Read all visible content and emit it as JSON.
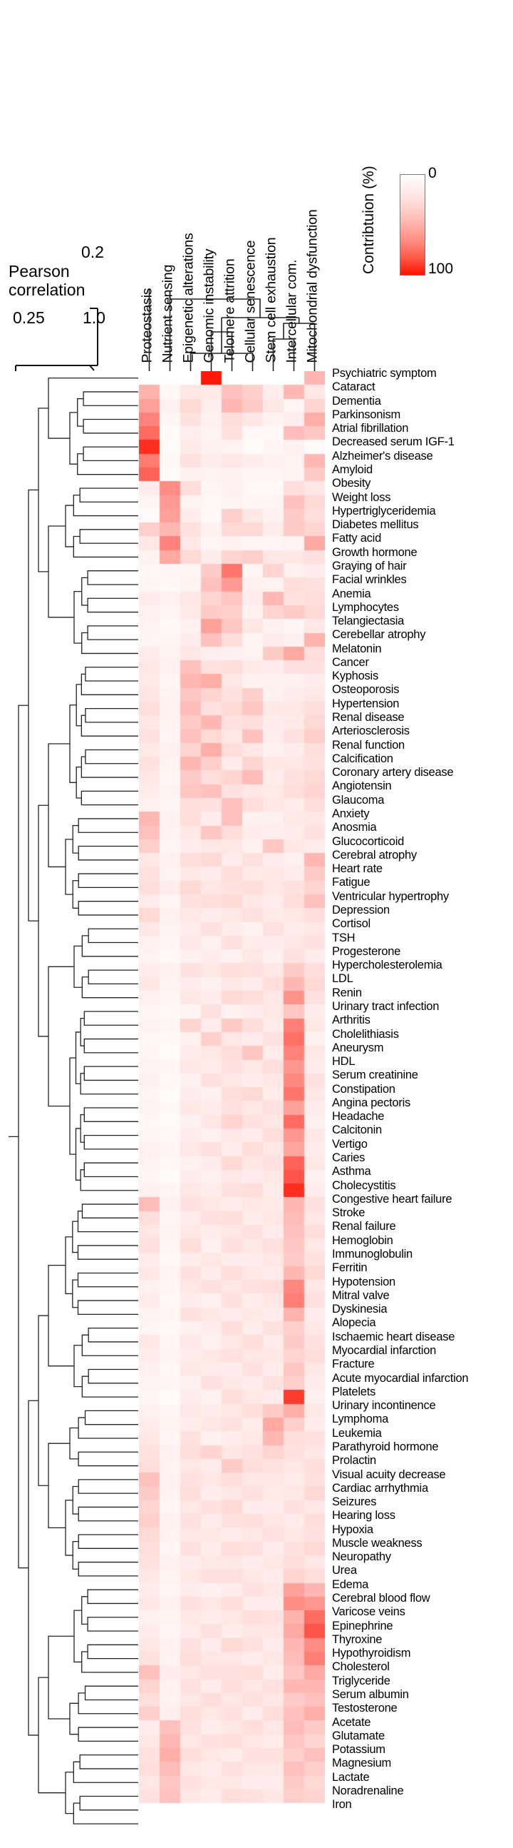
{
  "legend": {
    "title": "Contribtuion (%)",
    "max_label": "0",
    "min_label": "100",
    "color_low": "#ffffff",
    "color_high": "#ff1100"
  },
  "pearson": {
    "top_tick": "0.2",
    "label": "Pearson\ncorrelation",
    "label_line1": "Pearson",
    "label_line2": "correlation",
    "axis_low": "0.25",
    "axis_high": "1.0"
  },
  "chart_data": {
    "type": "heatmap",
    "title": "",
    "xlabel": "",
    "ylabel": "",
    "colorbar": {
      "label": "Contribtuion (%)",
      "min": 0,
      "max": 100,
      "low_color": "#ffffff",
      "high_color": "#ff1100"
    },
    "columns": [
      "Proteostasis",
      "Nutrient sensing",
      "Epigenetic alterations",
      "Genomic instability",
      "Telomere attrition",
      "Cellular senescence",
      "Stem cell exhaustion",
      "Intercellular com.",
      "Mitochondrial dysfunction"
    ],
    "rows": [
      "Psychiatric symptom",
      "Cataract",
      "Dementia",
      "Parkinsonism",
      "Atrial fibrillation",
      "Decreased serum IGF-1",
      "Alzheimer's disease",
      "Amyloid",
      "Obesity",
      "Weight loss",
      "Hypertriglyceridemia",
      "Diabetes mellitus",
      "Fatty acid",
      "Growth hormone",
      "Graying of hair",
      "Facial wrinkles",
      "Anemia",
      "Lymphocytes",
      "Telangiectasia",
      "Cerebellar atrophy",
      "Melatonin",
      "Cancer",
      "Kyphosis",
      "Osteoporosis",
      "Hypertension",
      "Renal disease",
      "Arteriosclerosis",
      "Renal function",
      "Calcification",
      "Coronary artery disease",
      "Angiotensin",
      "Glaucoma",
      "Anxiety",
      "Anosmia",
      "Glucocorticoid",
      "Cerebral atrophy",
      "Heart rate",
      "Fatigue",
      "Ventricular hypertrophy",
      "Depression",
      "Cortisol",
      "TSH",
      "Progesterone",
      "Hypercholesterolemia",
      "LDL",
      "Renin",
      "Urinary tract infection",
      "Arthritis",
      "Cholelithiasis",
      "Aneurysm",
      "HDL",
      "Serum creatinine",
      "Constipation",
      "Angina pectoris",
      "Headache",
      "Calcitonin",
      "Vertigo",
      "Caries",
      "Asthma",
      "Cholecystitis",
      "Congestive heart failure",
      "Stroke",
      "Renal failure",
      "Hemoglobin",
      "Immunoglobulin",
      "Ferritin",
      "Hypotension",
      "Mitral valve",
      "Dyskinesia",
      "Alopecia",
      "Ischaemic heart disease",
      "Myocardial infarction",
      "Fracture",
      "Acute myocardial infarction",
      "Platelets",
      "Urinary incontinence",
      "Lymphoma",
      "Leukemia",
      "Parathyroid hormone",
      "Prolactin",
      "Visual acuity decrease",
      "Cardiac arrhythmia",
      "Seizures",
      "Hearing loss",
      "Hypoxia",
      "Muscle weakness",
      "Neuropathy",
      "Urea",
      "Edema",
      "Cerebral blood flow",
      "Varicose veins",
      "Epinephrine",
      "Thyroxine",
      "Hypothyroidism",
      "Cholesterol",
      "Triglyceride",
      "Serum albumin",
      "Testosterone",
      "Acetate",
      "Glutamate",
      "Potassium",
      "Magnesium",
      "Lactate",
      "Noradrenaline",
      "Iron"
    ],
    "values": [
      [
        0,
        0,
        0,
        96,
        0,
        0,
        0,
        0,
        30
      ],
      [
        32,
        3,
        10,
        9,
        26,
        20,
        7,
        30,
        10
      ],
      [
        40,
        6,
        16,
        7,
        30,
        22,
        10,
        4,
        18
      ],
      [
        52,
        4,
        12,
        6,
        14,
        10,
        5,
        7,
        34
      ],
      [
        62,
        2,
        7,
        5,
        12,
        3,
        3,
        28,
        24
      ],
      [
        88,
        2,
        9,
        6,
        5,
        2,
        4,
        6,
        2
      ],
      [
        55,
        3,
        12,
        8,
        10,
        8,
        6,
        5,
        30
      ],
      [
        66,
        2,
        6,
        5,
        6,
        4,
        4,
        5,
        22
      ],
      [
        8,
        48,
        14,
        4,
        6,
        3,
        3,
        14,
        10
      ],
      [
        4,
        42,
        5,
        3,
        5,
        4,
        4,
        26,
        16
      ],
      [
        2,
        40,
        8,
        3,
        20,
        10,
        6,
        22,
        14
      ],
      [
        20,
        30,
        12,
        6,
        16,
        16,
        8,
        22,
        18
      ],
      [
        10,
        52,
        10,
        4,
        6,
        4,
        4,
        5,
        36
      ],
      [
        5,
        36,
        16,
        8,
        18,
        20,
        10,
        10,
        12
      ],
      [
        3,
        4,
        4,
        22,
        58,
        4,
        18,
        6,
        8
      ],
      [
        4,
        3,
        5,
        26,
        42,
        6,
        5,
        14,
        12
      ],
      [
        8,
        6,
        10,
        18,
        24,
        8,
        30,
        12,
        14
      ],
      [
        6,
        4,
        9,
        22,
        20,
        6,
        18,
        22,
        16
      ],
      [
        5,
        3,
        6,
        40,
        24,
        10,
        6,
        4,
        10
      ],
      [
        4,
        4,
        8,
        26,
        14,
        5,
        8,
        6,
        32
      ],
      [
        8,
        5,
        10,
        7,
        6,
        5,
        22,
        36,
        14
      ],
      [
        10,
        6,
        26,
        12,
        14,
        9,
        8,
        12,
        12
      ],
      [
        9,
        4,
        30,
        34,
        10,
        6,
        6,
        6,
        8
      ],
      [
        11,
        5,
        24,
        18,
        12,
        20,
        6,
        8,
        10
      ],
      [
        14,
        6,
        28,
        12,
        16,
        24,
        10,
        10,
        14
      ],
      [
        10,
        5,
        22,
        30,
        12,
        14,
        8,
        9,
        16
      ],
      [
        12,
        4,
        26,
        16,
        10,
        26,
        7,
        12,
        20
      ],
      [
        9,
        6,
        18,
        34,
        14,
        10,
        6,
        8,
        14
      ],
      [
        12,
        5,
        30,
        20,
        8,
        18,
        10,
        10,
        12
      ],
      [
        10,
        4,
        22,
        14,
        18,
        28,
        8,
        12,
        16
      ],
      [
        8,
        5,
        24,
        26,
        12,
        10,
        9,
        14,
        18
      ],
      [
        6,
        4,
        14,
        12,
        26,
        14,
        10,
        8,
        14
      ],
      [
        30,
        6,
        14,
        8,
        26,
        6,
        6,
        9,
        10
      ],
      [
        26,
        5,
        10,
        24,
        14,
        8,
        7,
        8,
        12
      ],
      [
        20,
        4,
        8,
        10,
        10,
        6,
        24,
        10,
        8
      ],
      [
        10,
        6,
        14,
        16,
        8,
        12,
        8,
        6,
        30
      ],
      [
        12,
        5,
        10,
        8,
        14,
        9,
        10,
        8,
        22
      ],
      [
        14,
        8,
        16,
        10,
        12,
        14,
        10,
        12,
        18
      ],
      [
        8,
        4,
        12,
        14,
        16,
        10,
        8,
        14,
        26
      ],
      [
        16,
        6,
        10,
        8,
        10,
        12,
        9,
        10,
        14
      ],
      [
        10,
        5,
        8,
        12,
        8,
        6,
        12,
        8,
        10
      ],
      [
        6,
        4,
        10,
        6,
        12,
        8,
        8,
        10,
        12
      ],
      [
        5,
        3,
        6,
        8,
        6,
        10,
        6,
        12,
        8
      ],
      [
        8,
        6,
        12,
        10,
        14,
        12,
        10,
        22,
        14
      ],
      [
        10,
        5,
        8,
        6,
        10,
        8,
        14,
        30,
        16
      ],
      [
        6,
        4,
        10,
        8,
        16,
        14,
        10,
        46,
        12
      ],
      [
        4,
        3,
        5,
        12,
        6,
        8,
        10,
        24,
        8
      ],
      [
        5,
        4,
        18,
        8,
        22,
        14,
        8,
        54,
        10
      ],
      [
        3,
        3,
        6,
        20,
        10,
        8,
        12,
        60,
        6
      ],
      [
        4,
        2,
        8,
        10,
        14,
        24,
        8,
        52,
        10
      ],
      [
        5,
        4,
        10,
        8,
        12,
        10,
        14,
        44,
        8
      ],
      [
        6,
        3,
        6,
        12,
        10,
        8,
        10,
        50,
        12
      ],
      [
        4,
        2,
        8,
        6,
        14,
        16,
        8,
        58,
        10
      ],
      [
        5,
        3,
        10,
        8,
        12,
        10,
        12,
        40,
        8
      ],
      [
        3,
        2,
        6,
        10,
        18,
        12,
        10,
        62,
        6
      ],
      [
        4,
        3,
        8,
        6,
        10,
        8,
        14,
        44,
        10
      ],
      [
        6,
        4,
        10,
        12,
        8,
        14,
        10,
        38,
        8
      ],
      [
        5,
        3,
        6,
        8,
        16,
        10,
        12,
        66,
        10
      ],
      [
        4,
        2,
        8,
        6,
        10,
        8,
        10,
        72,
        6
      ],
      [
        6,
        4,
        10,
        8,
        12,
        14,
        8,
        88,
        8
      ],
      [
        28,
        6,
        12,
        10,
        8,
        10,
        9,
        30,
        12
      ],
      [
        14,
        4,
        8,
        12,
        14,
        8,
        10,
        28,
        10
      ],
      [
        10,
        5,
        10,
        8,
        10,
        12,
        8,
        26,
        14
      ],
      [
        12,
        4,
        14,
        6,
        12,
        10,
        12,
        24,
        10
      ],
      [
        8,
        3,
        8,
        10,
        8,
        8,
        10,
        22,
        12
      ],
      [
        10,
        5,
        12,
        8,
        14,
        10,
        8,
        30,
        16
      ],
      [
        6,
        4,
        10,
        12,
        10,
        12,
        14,
        50,
        10
      ],
      [
        8,
        3,
        8,
        6,
        12,
        8,
        10,
        54,
        12
      ],
      [
        5,
        4,
        12,
        10,
        8,
        10,
        8,
        32,
        8
      ],
      [
        4,
        3,
        6,
        8,
        14,
        8,
        12,
        20,
        10
      ],
      [
        10,
        4,
        10,
        6,
        10,
        14,
        8,
        22,
        12
      ],
      [
        8,
        5,
        8,
        10,
        12,
        10,
        10,
        18,
        14
      ],
      [
        6,
        3,
        10,
        8,
        8,
        12,
        8,
        24,
        10
      ],
      [
        5,
        4,
        6,
        12,
        10,
        8,
        12,
        20,
        8
      ],
      [
        4,
        2,
        8,
        6,
        14,
        10,
        8,
        82,
        6
      ],
      [
        6,
        4,
        10,
        8,
        10,
        14,
        22,
        34,
        10
      ],
      [
        8,
        5,
        8,
        10,
        12,
        8,
        36,
        20,
        8
      ],
      [
        10,
        4,
        12,
        6,
        8,
        10,
        30,
        14,
        12
      ],
      [
        12,
        6,
        14,
        18,
        10,
        12,
        18,
        12,
        10
      ],
      [
        14,
        5,
        10,
        8,
        22,
        14,
        12,
        10,
        14
      ],
      [
        26,
        6,
        12,
        10,
        14,
        10,
        10,
        8,
        12
      ],
      [
        22,
        5,
        14,
        8,
        10,
        12,
        9,
        10,
        16
      ],
      [
        18,
        4,
        10,
        12,
        16,
        8,
        8,
        12,
        10
      ],
      [
        20,
        6,
        12,
        8,
        12,
        14,
        10,
        8,
        14
      ],
      [
        16,
        5,
        10,
        10,
        8,
        10,
        12,
        10,
        12
      ],
      [
        14,
        4,
        12,
        8,
        14,
        12,
        8,
        12,
        16
      ],
      [
        12,
        6,
        8,
        10,
        10,
        8,
        10,
        14,
        10
      ],
      [
        10,
        5,
        10,
        12,
        12,
        10,
        8,
        18,
        14
      ],
      [
        8,
        4,
        8,
        6,
        8,
        12,
        10,
        40,
        30
      ],
      [
        10,
        6,
        12,
        10,
        14,
        8,
        8,
        48,
        44
      ],
      [
        6,
        5,
        10,
        8,
        10,
        14,
        12,
        32,
        62
      ],
      [
        8,
        4,
        8,
        12,
        8,
        10,
        10,
        36,
        72
      ],
      [
        10,
        6,
        12,
        8,
        16,
        12,
        8,
        30,
        48
      ],
      [
        12,
        5,
        14,
        10,
        10,
        8,
        10,
        28,
        54
      ],
      [
        26,
        8,
        10,
        12,
        12,
        14,
        8,
        24,
        36
      ],
      [
        18,
        6,
        12,
        8,
        14,
        10,
        12,
        30,
        30
      ],
      [
        14,
        5,
        10,
        14,
        10,
        12,
        10,
        22,
        26
      ],
      [
        20,
        7,
        14,
        10,
        12,
        8,
        14,
        26,
        34
      ],
      [
        8,
        26,
        12,
        8,
        10,
        14,
        10,
        28,
        22
      ],
      [
        10,
        30,
        10,
        12,
        14,
        10,
        8,
        24,
        18
      ],
      [
        12,
        34,
        14,
        10,
        8,
        12,
        12,
        20,
        26
      ],
      [
        14,
        28,
        10,
        8,
        12,
        10,
        10,
        26,
        20
      ],
      [
        10,
        24,
        12,
        10,
        10,
        8,
        8,
        22,
        16
      ],
      [
        12,
        26,
        10,
        8,
        14,
        12,
        10,
        20,
        18
      ]
    ]
  }
}
